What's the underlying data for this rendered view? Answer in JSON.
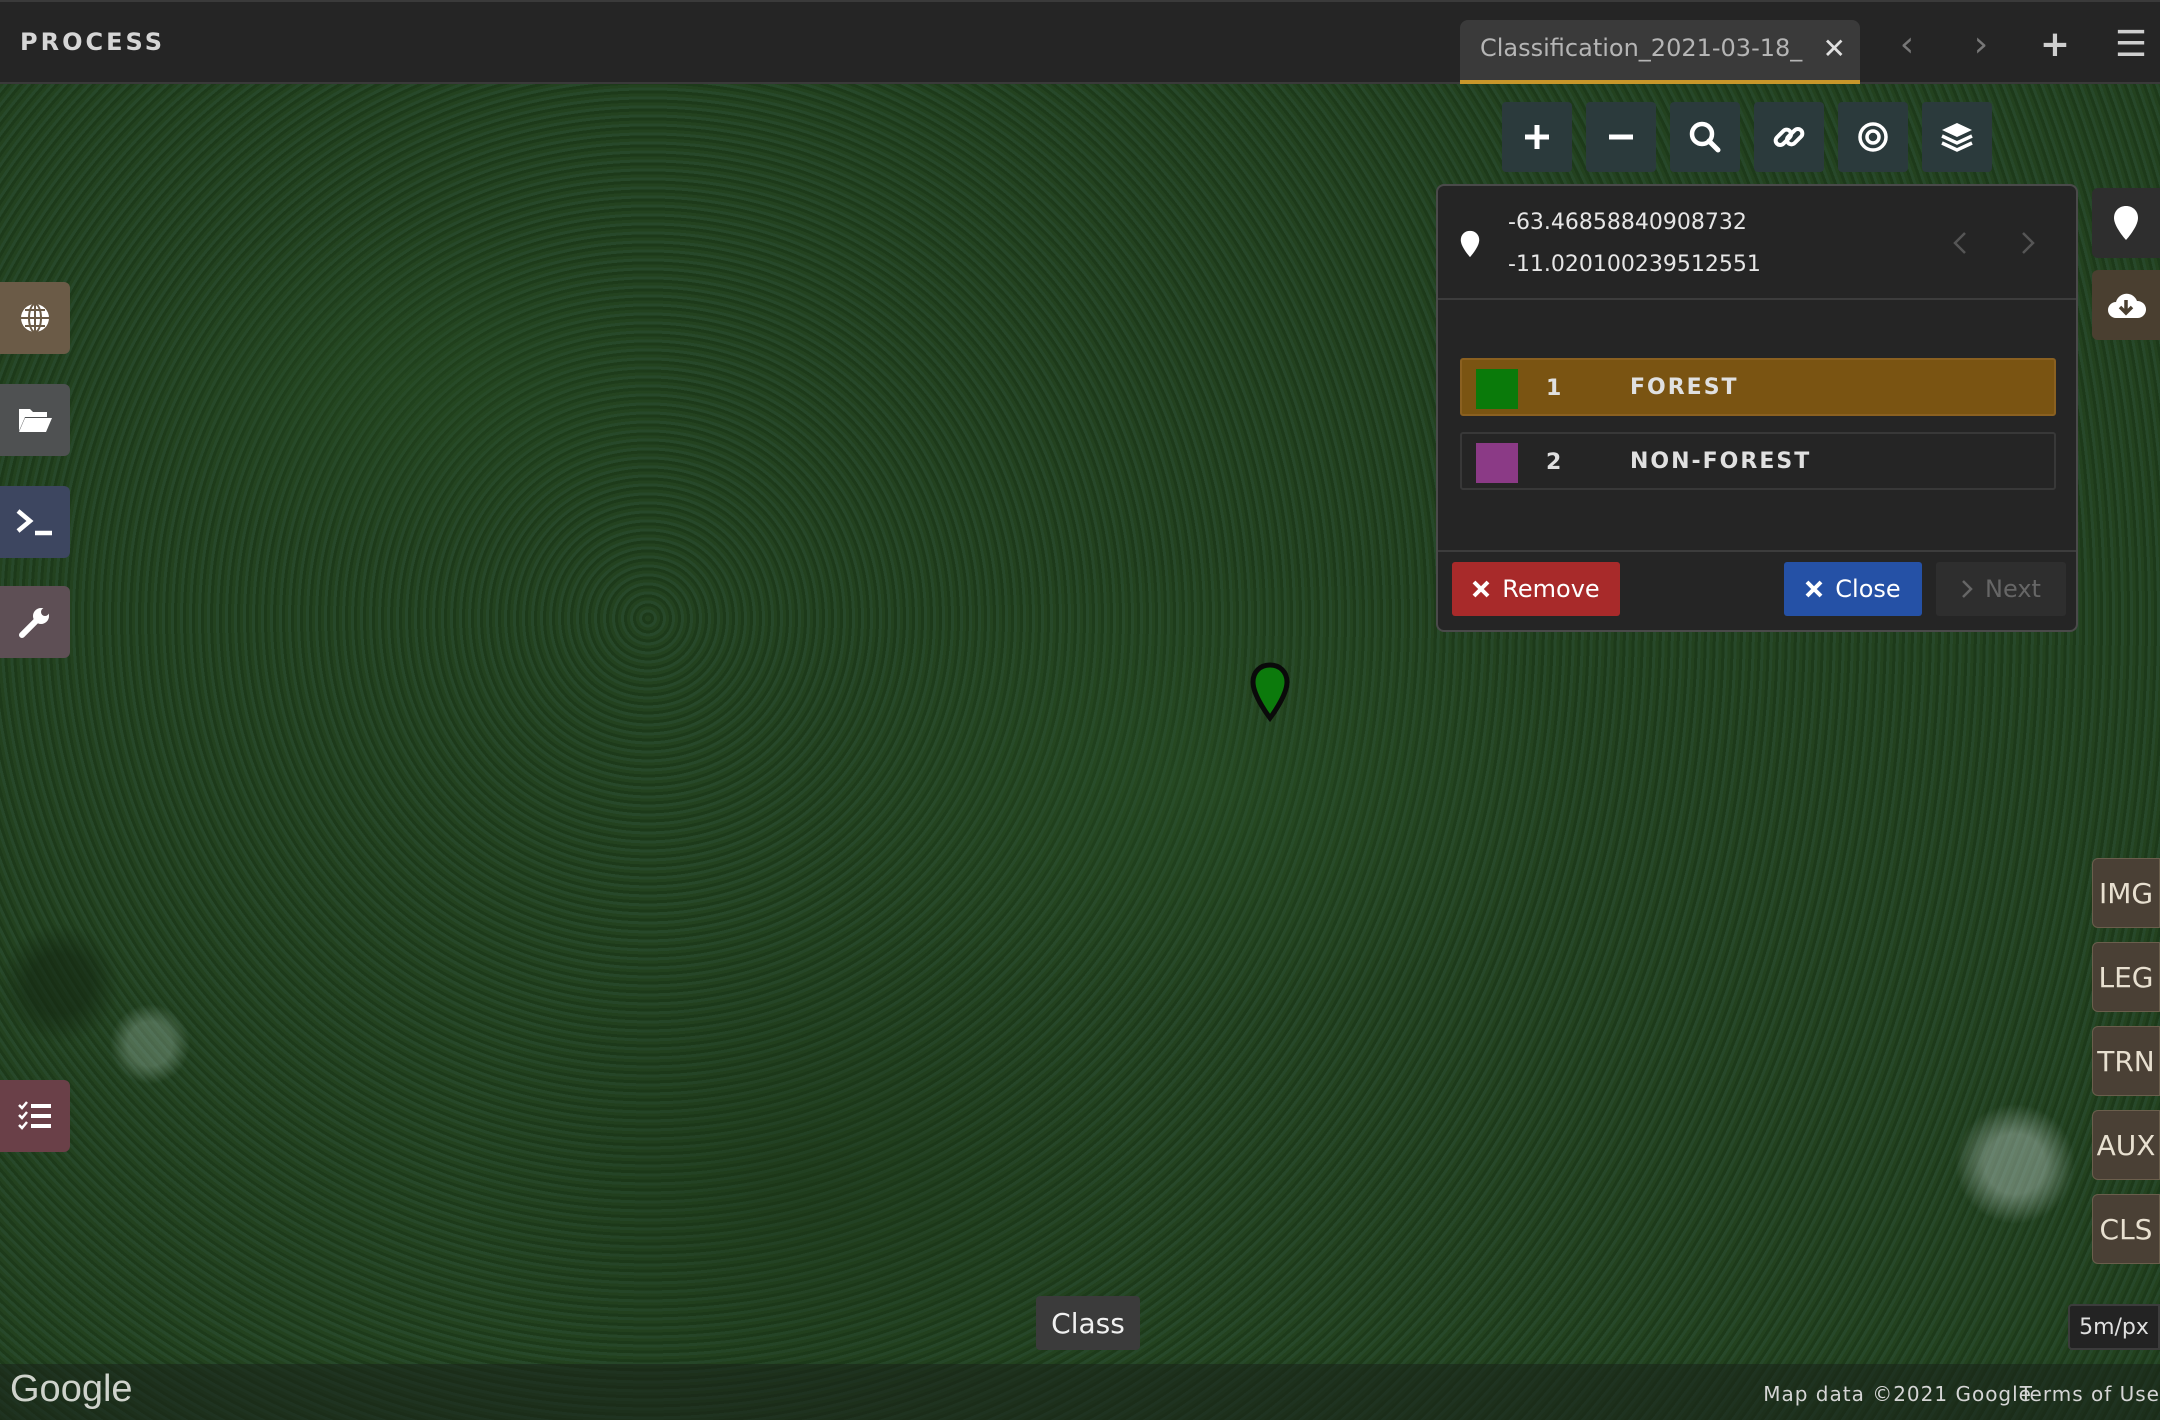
{
  "app": {
    "title": "PROCESS"
  },
  "tab": {
    "label": "Classification_2021-03-18_",
    "close_label": "✕"
  },
  "topbar": {
    "prev_label": "‹",
    "next_label": "›",
    "add_label": "+",
    "menu_label": "☰"
  },
  "panel": {
    "lon": "-63.46858840908732",
    "lat": "-11.020100239512551",
    "classes": [
      {
        "value": "1",
        "name": "FOREST",
        "color": "#0a7a0a",
        "selected": true
      },
      {
        "value": "2",
        "name": "NON-FOREST",
        "color": "#8b3a86",
        "selected": false
      }
    ],
    "remove_label": "Remove",
    "close_label": "Close",
    "next_label": "Next"
  },
  "right_tabs": [
    "IMG",
    "LEG",
    "TRN",
    "AUX",
    "CLS"
  ],
  "map": {
    "tooltip": "Class",
    "scale": "5m/px",
    "google": "Google",
    "map_data": "Map data ©2021 Google",
    "terms": "Terms of Use"
  },
  "colors": {
    "accent": "#c8962a",
    "remove": "#a82a2a",
    "close": "#2551a6"
  }
}
